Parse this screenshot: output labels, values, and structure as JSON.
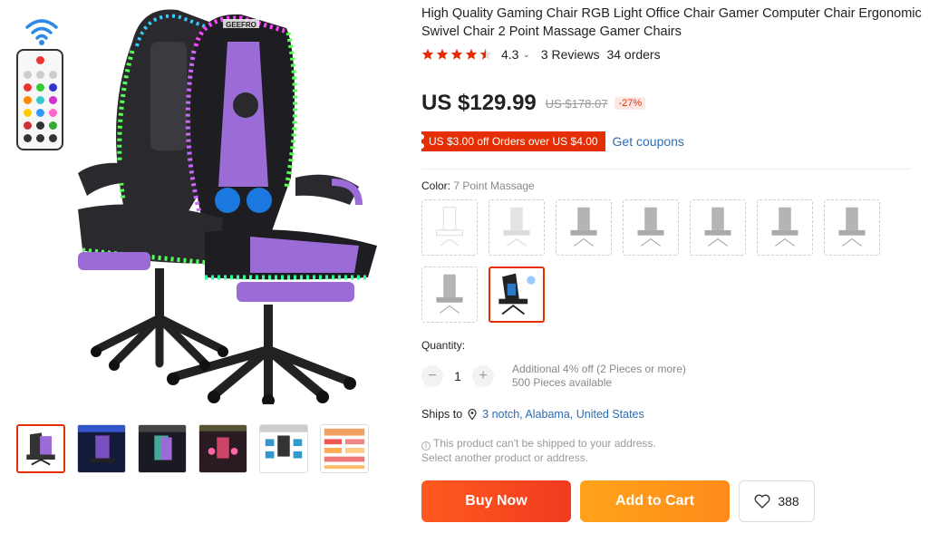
{
  "product": {
    "title": "High Quality Gaming Chair RGB Light Office Chair Gamer Computer Chair Ergonomic Swivel Chair 2 Point Massage Gamer Chairs",
    "rating": "4.3",
    "stars": 4.5,
    "reviews": "3 Reviews",
    "orders": "34 orders"
  },
  "pricing": {
    "price": "US $129.99",
    "old_price": "US $178.07",
    "discount": "-27%"
  },
  "coupon": {
    "tag": "US $3.00 off Orders over US $4.00",
    "link": "Get coupons"
  },
  "color": {
    "label": "Color: ",
    "selected": "7 Point Massage",
    "swatch_count": 9,
    "selected_index": 8
  },
  "quantity": {
    "label": "Quantity:",
    "value": "1",
    "minus": "−",
    "plus": "+",
    "note_line1": "Additional 4% off (2 Pieces or more)",
    "note_line2": "500 Pieces available"
  },
  "shipping": {
    "label": "Ships to",
    "location": "3 notch, Alabama, United States",
    "warning_line1": "This product can't be shipped to your address.",
    "warning_line2": "Select another product or address."
  },
  "actions": {
    "buy_now": "Buy Now",
    "add_to_cart": "Add to Cart",
    "wishlist_count": "388"
  },
  "gallery": {
    "thumb_count": 6,
    "active_index": 0,
    "chair_brand": "GEEFRO"
  },
  "colors": {
    "accent": "#e62e04",
    "link": "#2e6bb3",
    "buy": "#f13b1f",
    "cart": "#ff961a",
    "chair_purple": "#9b6bd6"
  }
}
